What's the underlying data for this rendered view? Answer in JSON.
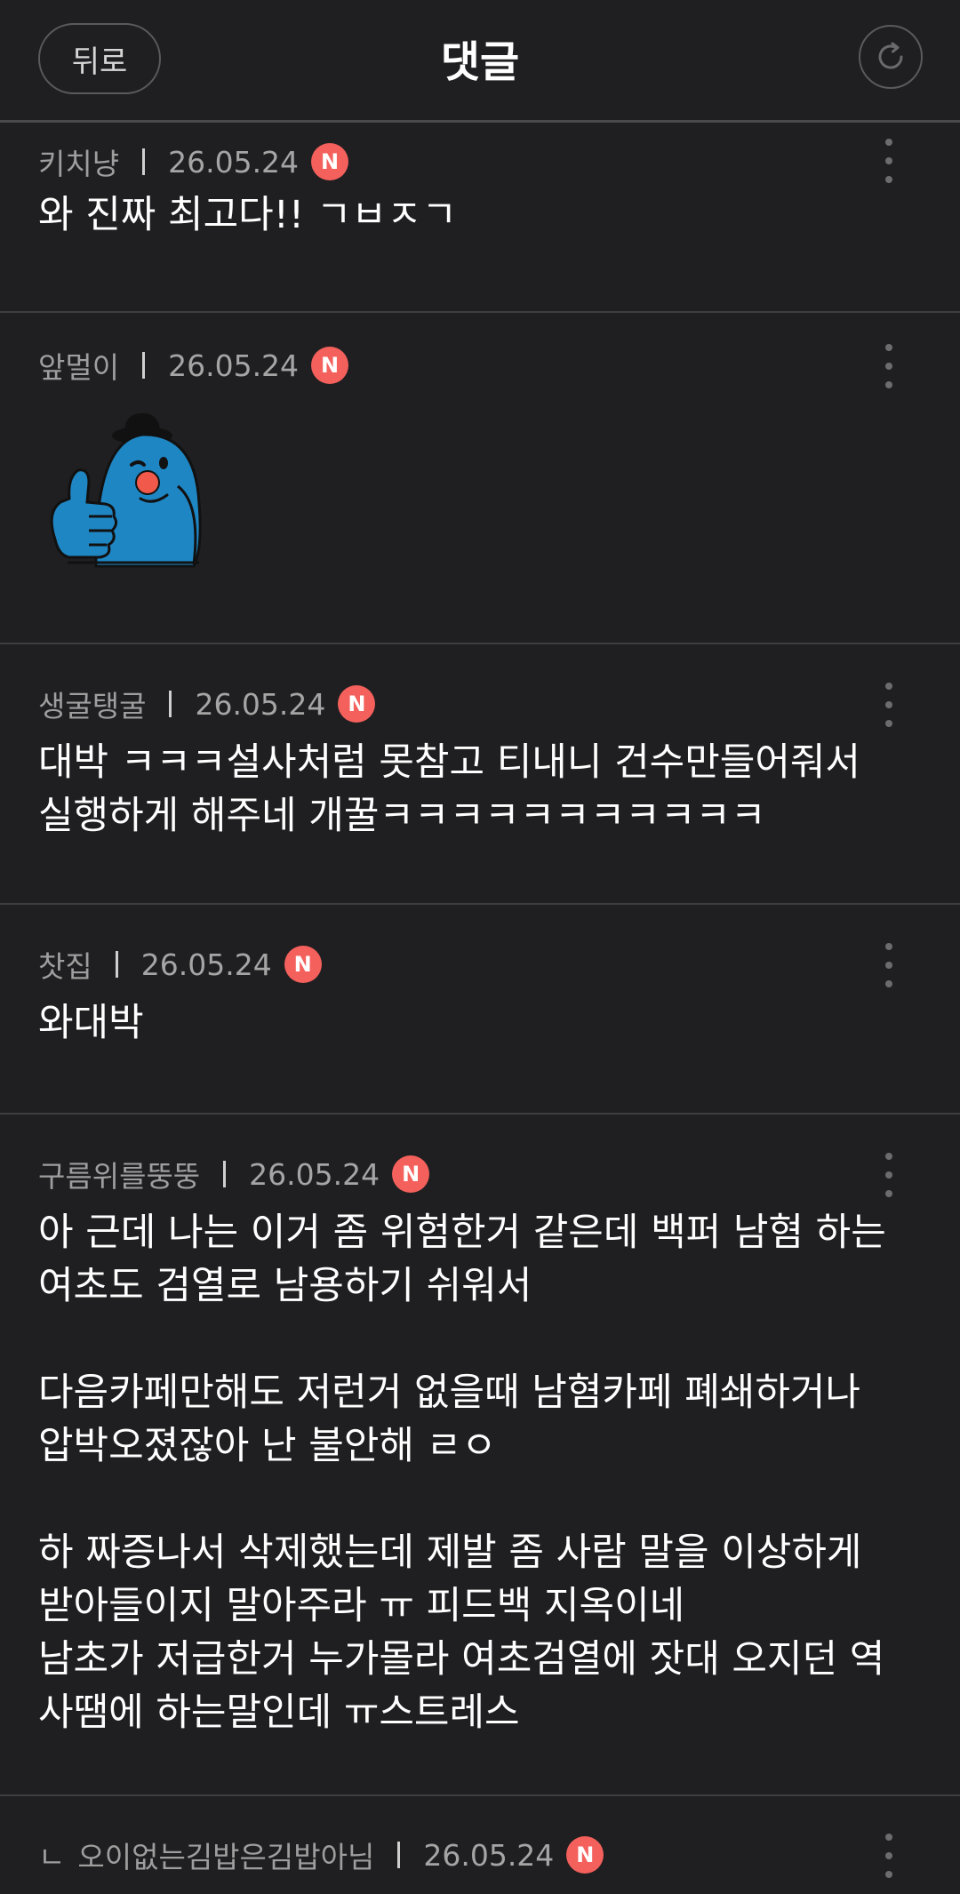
{
  "header": {
    "back_label": "뒤로",
    "title": "댓글",
    "refresh_icon": "refresh-icon"
  },
  "comments": [
    {
      "author": "키치냥",
      "date": "26.05.24",
      "badge": "N",
      "text": "와 진짜 최고다!! ㄱㅂㅈㄱ"
    },
    {
      "author": "앞멀이",
      "date": "26.05.24",
      "badge": "N",
      "sticker": "thumbs-up-blue-character-sticker"
    },
    {
      "author": "생굴탱굴",
      "date": "26.05.24",
      "badge": "N",
      "text": "대박 ㅋㅋㅋ설사처럼 못참고 티내니 건수만들어줘서\n실행하게 해주네 개꿀ㅋㅋㅋㅋㅋㅋㅋㅋㅋㅋㅋ"
    },
    {
      "author": "찻집",
      "date": "26.05.24",
      "badge": "N",
      "text": "와대박"
    },
    {
      "author": "구름위를뚱뚱",
      "date": "26.05.24",
      "badge": "N",
      "text": "아 근데 나는 이거 좀 위험한거 같은데 백퍼 남혐 하는\n여초도 검열로 남용하기 쉬워서\n\n다음카페만해도 저런거 없을때 남혐카페 폐쇄하거나\n압박오졌잖아 난 불안해 ㄹㅇ\n\n하 짜증나서 삭제했는데 제발 좀 사람 말을 이상하게\n받아들이지 말아주라 ㅠ 피드백 지옥이네\n남초가 저급한거 누가몰라 여초검열에 잣대 오지던 역\n사땜에 하는말인데 ㅠ스트레스"
    },
    {
      "reply_mark": "ㄴ",
      "author": "오이없는김밥은김밥아님",
      "date": "26.05.24",
      "badge": "N"
    }
  ],
  "colors": {
    "background": "#1f1f21",
    "badge": "#f4605c",
    "sticker_body": "#1f86c4"
  }
}
